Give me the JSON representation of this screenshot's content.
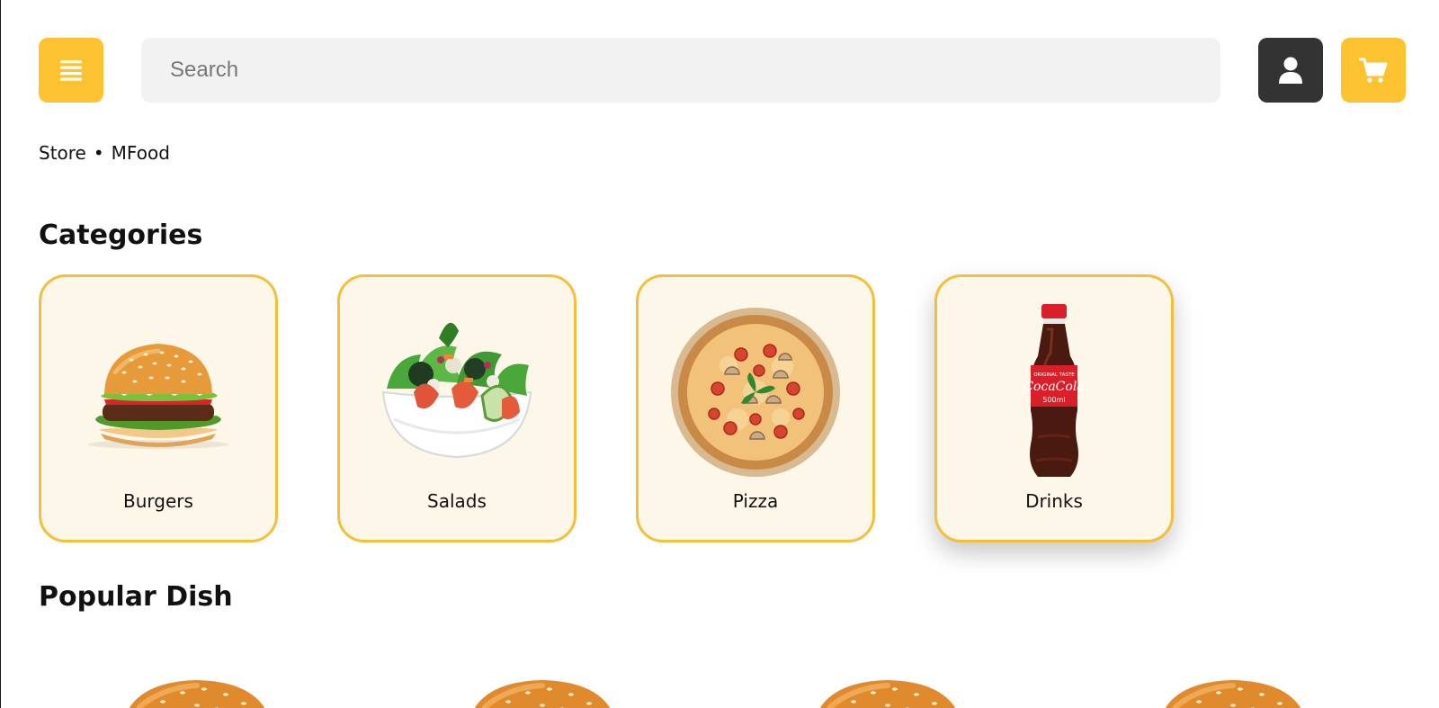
{
  "header": {
    "search_placeholder": "Search",
    "menu_icon": "menu-icon",
    "user_icon": "user-icon",
    "cart_icon": "cart-icon"
  },
  "breadcrumb": {
    "store": "Store",
    "separator": "•",
    "current": "MFood"
  },
  "categories": {
    "title": "Categories",
    "items": [
      {
        "label": "Burgers",
        "icon": "burger-image"
      },
      {
        "label": "Salads",
        "icon": "salad-image"
      },
      {
        "label": "Pizza",
        "icon": "pizza-image"
      },
      {
        "label": "Drinks",
        "icon": "cola-bottle-image"
      }
    ]
  },
  "popular": {
    "title": "Popular Dish"
  },
  "colors": {
    "accent": "#fdc22f",
    "dark": "#333333",
    "card_bg": "#fdf7ea",
    "card_border": "#f4bf3a",
    "search_bg": "#f2f2f2"
  }
}
